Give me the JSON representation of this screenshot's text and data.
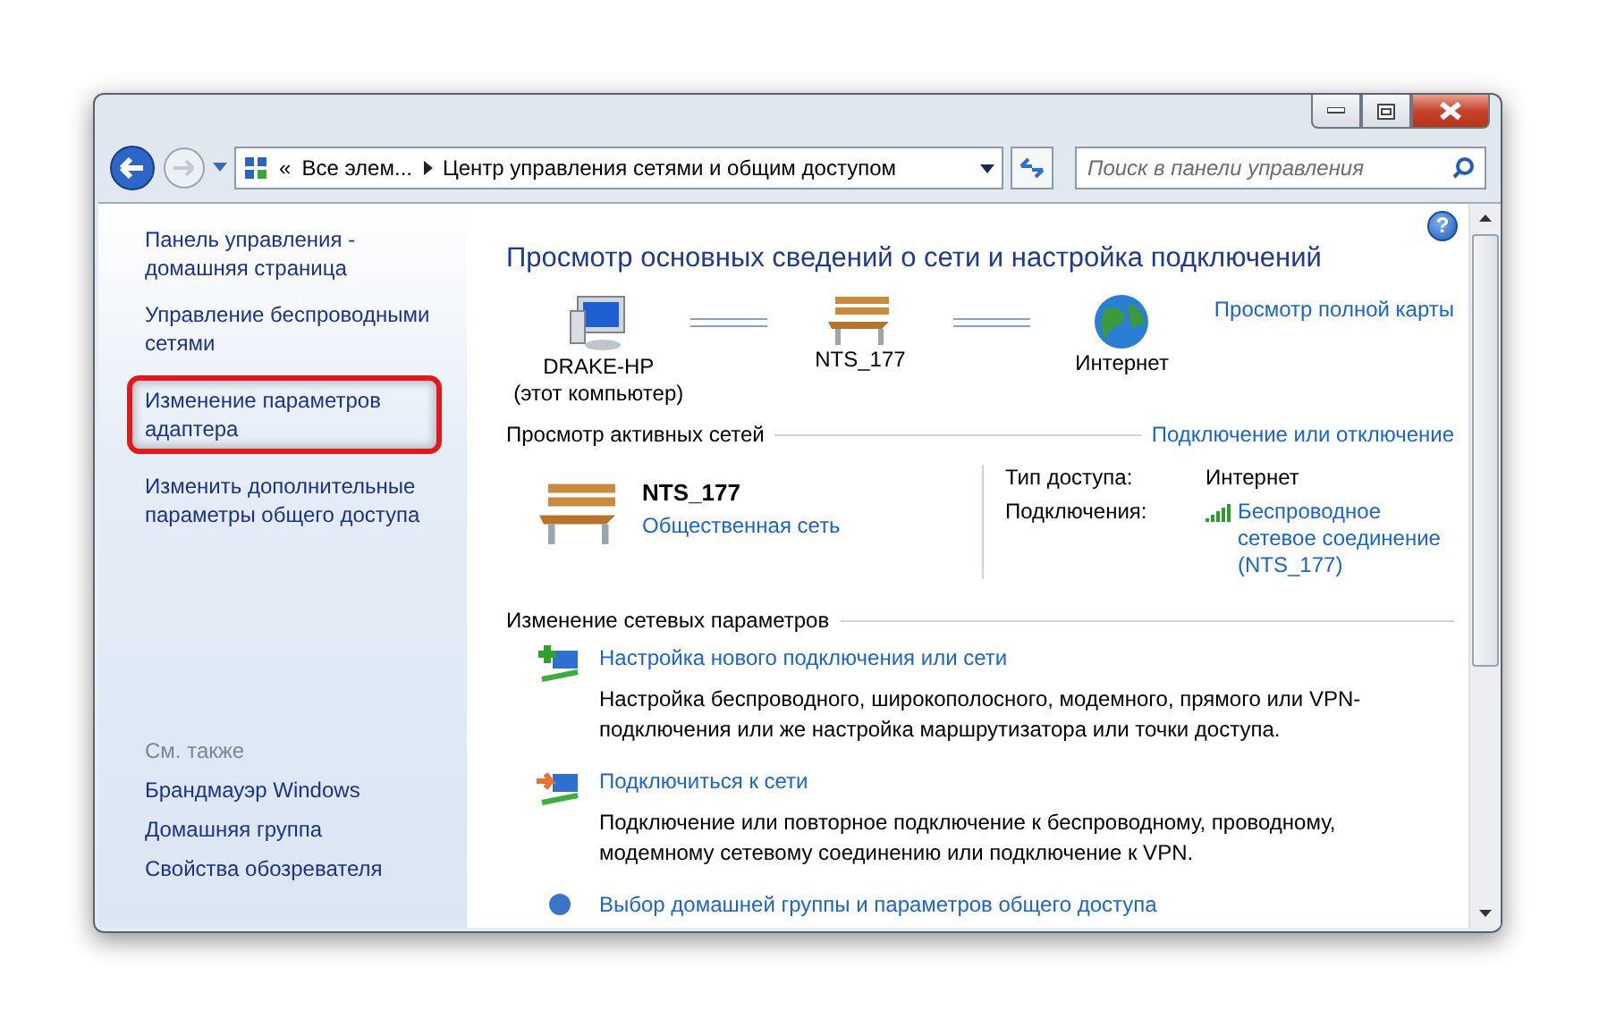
{
  "address_bar": {
    "chevron": "«",
    "crumbs": [
      "Все элем...",
      "Центр управления сетями и общим доступом"
    ]
  },
  "search": {
    "placeholder": "Поиск в панели управления"
  },
  "help": "?",
  "sidebar": {
    "items": [
      {
        "label": "Панель управления - домашняя страница",
        "highlighted": false
      },
      {
        "label": "Управление беспроводными сетями",
        "highlighted": false
      },
      {
        "label": "Изменение параметров адаптера",
        "highlighted": true
      },
      {
        "label": "Изменить дополнительные параметры общего доступа",
        "highlighted": false
      }
    ],
    "see_also": {
      "heading": "См. также",
      "items": [
        "Брандмауэр Windows",
        "Домашняя группа",
        "Свойства обозревателя"
      ]
    }
  },
  "main": {
    "title": "Просмотр основных сведений о сети и настройка подключений",
    "map": {
      "nodes": [
        {
          "kind": "computer",
          "label": "DRAKE-HP",
          "sublabel": "(этот компьютер)"
        },
        {
          "kind": "bench",
          "label": "NTS_177"
        },
        {
          "kind": "globe",
          "label": "Интернет"
        }
      ],
      "full_map_link": "Просмотр полной карты"
    },
    "active_networks": {
      "heading": "Просмотр активных сетей",
      "link": "Подключение или отключение",
      "network": {
        "name": "NTS_177",
        "type": "Общественная сеть"
      },
      "details": [
        {
          "kind": "text",
          "label": "Тип доступа:",
          "value": "Интернет"
        },
        {
          "kind": "link",
          "label": "Подключения:",
          "value": "Беспроводное сетевое соединение (NTS_177)"
        }
      ]
    },
    "settings": {
      "heading": "Изменение сетевых параметров",
      "tasks": [
        {
          "kind": "add",
          "title": "Настройка нового подключения или сети",
          "description": "Настройка беспроводного, широкополосного, модемного, прямого или VPN-подключения или же настройка маршрутизатора или точки доступа."
        },
        {
          "kind": "connect",
          "title": "Подключиться к сети",
          "description": "Подключение или повторное подключение к беспроводному, проводному, модемному сетевому соединению или подключение к VPN."
        },
        {
          "kind": "homegroup",
          "title": "Выбор домашней группы и параметров общего доступа"
        }
      ]
    }
  }
}
